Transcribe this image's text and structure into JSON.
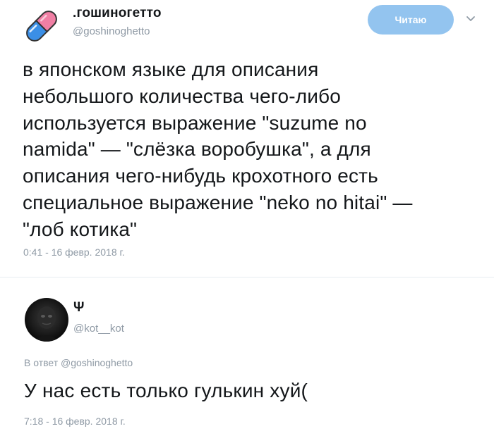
{
  "tweet": {
    "author_name": ".гошиногетто",
    "author_handle": "@goshinoghetto",
    "follow_label": "Читаю",
    "text": "в японском языке для описания\nнебольшого количества чего-либо\nиспользуется выражение \"suzume no\nnamida\" — \"слёзка воробушка\", а для\nописания чего-нибудь крохотного есть\nспециальное выражение \"neko no hitai\" —\n\"лоб котика\"",
    "timestamp": "0:41 - 16 февр. 2018 г.",
    "avatar_icon": "pill-capsule-icon"
  },
  "reply": {
    "author_name": "Ψ",
    "author_handle": "@kot__kot",
    "reply_to": "В ответ @goshinoghetto",
    "text": "У нас есть только гулькин хуй(",
    "timestamp": "7:18 - 16 февр. 2018 г.",
    "avatar_icon": "dark-portrait-avatar"
  },
  "colors": {
    "follow_button": "#93c4ef",
    "secondary_text": "#8f9aa5",
    "primary_text": "#14171a",
    "pill_blue": "#3b8fe6",
    "pill_pink": "#f07fa4"
  }
}
